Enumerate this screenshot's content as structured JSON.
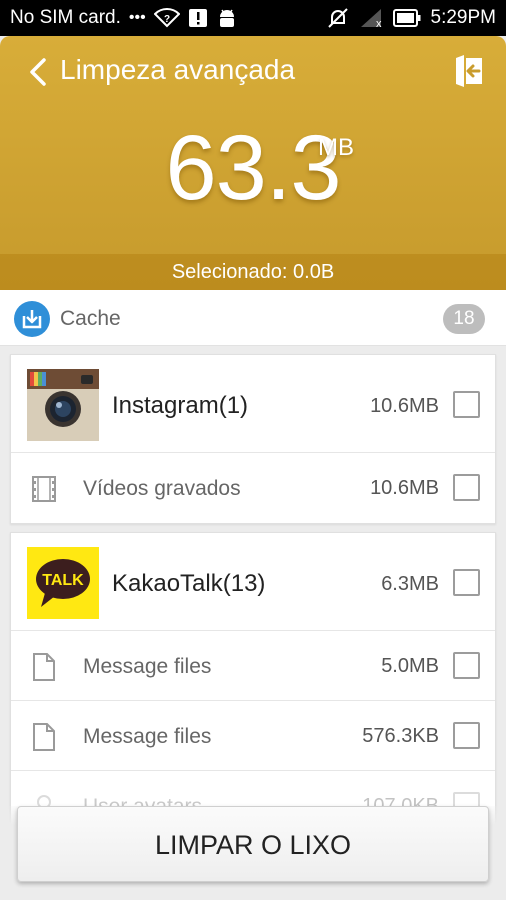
{
  "status_bar": {
    "carrier": "No SIM card.",
    "dots": "•••",
    "time": "5:29PM"
  },
  "header": {
    "title": "Limpeza avançada",
    "size_value": "63.3",
    "size_unit": "MB",
    "selected_text": "Selecionado: 0.0B"
  },
  "cache": {
    "label": "Cache",
    "count": "18"
  },
  "cards": [
    {
      "app": {
        "name": "Instagram(1)",
        "size": "10.6MB",
        "icon": "instagram-icon"
      },
      "items": [
        {
          "name": "Vídeos gravados",
          "size": "10.6MB",
          "icon": "film-icon"
        }
      ]
    },
    {
      "app": {
        "name": "KakaoTalk(13)",
        "size": "6.3MB",
        "icon": "kakaotalk-icon",
        "icon_text": "TALK"
      },
      "items": [
        {
          "name": "Message files",
          "size": "5.0MB",
          "icon": "file-icon"
        },
        {
          "name": "Message files",
          "size": "576.3KB",
          "icon": "file-icon"
        },
        {
          "name": "User avatars",
          "size": "107.0KB",
          "icon": "user-icon"
        }
      ]
    }
  ],
  "clean_button": {
    "label": "LIMPAR O LIXO"
  },
  "colors": {
    "header": "#d2a535",
    "cache_icon": "#2f8fd8",
    "kakao_yellow": "#ffe812"
  }
}
